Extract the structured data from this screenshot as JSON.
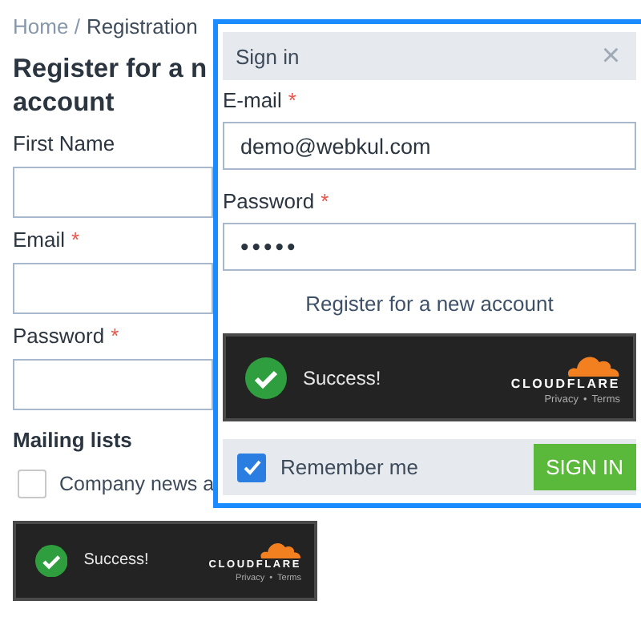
{
  "breadcrumb": {
    "items": [
      {
        "label": "Home",
        "separator": "/"
      },
      {
        "label": "Registration"
      }
    ]
  },
  "page": {
    "heading_line_1": "Register for a n",
    "heading_line_2": "account",
    "fields": [
      {
        "label": "First Name"
      },
      {
        "label": "Email",
        "required_mark": "*"
      },
      {
        "label": "Password",
        "required_mark": "*"
      }
    ],
    "mailing_lists": {
      "title": "Mailing lists",
      "options": [
        {
          "label": "Company news a",
          "checked": false
        }
      ]
    },
    "captcha": {
      "status": "Success!",
      "brand": "CLOUDFLARE",
      "privacy": "Privacy",
      "separator": "•",
      "terms": "Terms"
    }
  },
  "sign_in_dialog": {
    "title": "Sign in",
    "close": "×",
    "fields": [
      {
        "label": "E-mail",
        "required_mark": "*",
        "value": "demo@webkul.com",
        "kind": "text"
      },
      {
        "label": "Password",
        "required_mark": "*",
        "value": "•••••",
        "kind": "password"
      }
    ],
    "register_link": "Register for a new account",
    "captcha": {
      "status": "Success!",
      "brand": "CLOUDFLARE",
      "privacy": "Privacy",
      "separator": "•",
      "terms": "Terms"
    },
    "remember_me": {
      "label": "Remember me",
      "checked": true
    },
    "submit": "SIGN IN"
  }
}
